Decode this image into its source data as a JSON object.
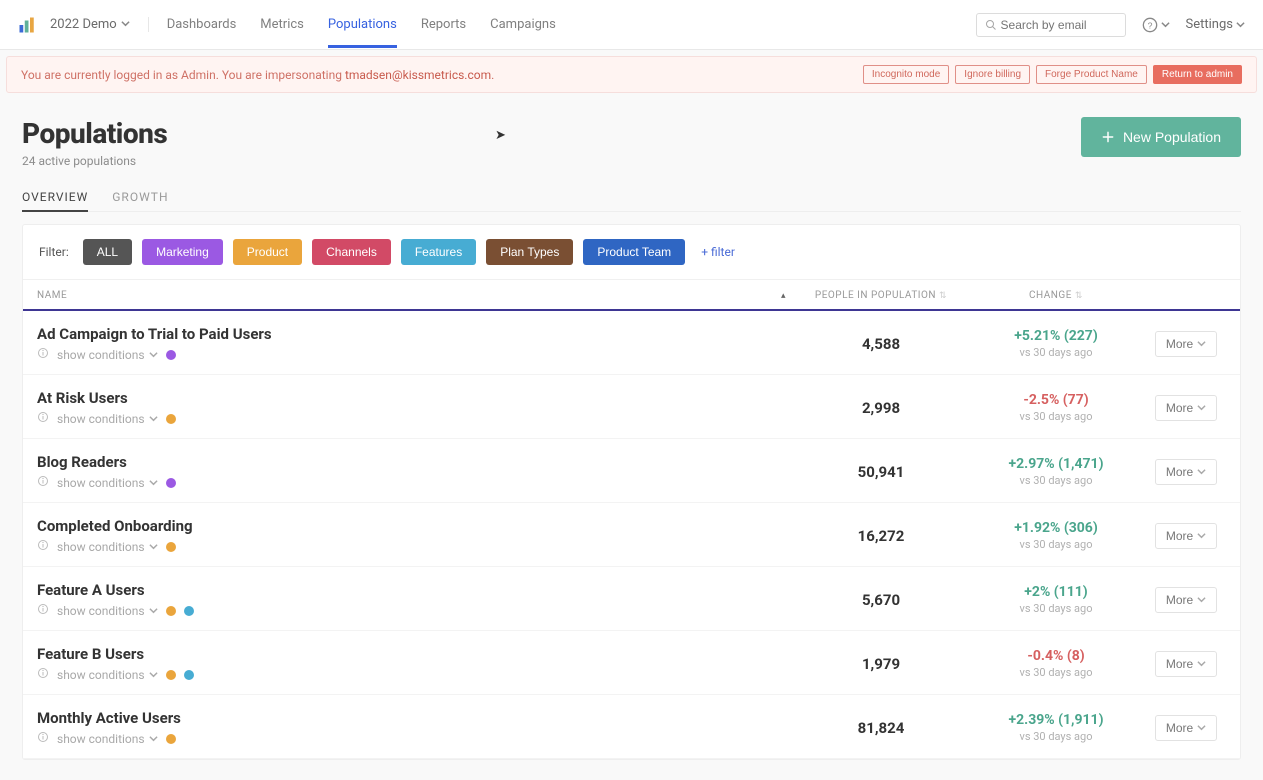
{
  "header": {
    "account_name": "2022 Demo",
    "nav": [
      "Dashboards",
      "Metrics",
      "Populations",
      "Reports",
      "Campaigns"
    ],
    "nav_active_index": 2,
    "search_placeholder": "Search by email",
    "settings_label": "Settings"
  },
  "impersonation": {
    "prefix": "You are currently logged in as Admin. You are impersonating ",
    "email": "tmadsen@kissmetrics.com",
    "suffix": ".",
    "buttons": [
      "Incognito mode",
      "Ignore billing",
      "Forge Product Name"
    ],
    "return_btn": "Return to admin"
  },
  "page": {
    "title": "Populations",
    "subtitle": "24 active populations",
    "tabs": [
      "OVERVIEW",
      "GROWTH"
    ],
    "active_tab": 0,
    "new_btn": "New Population",
    "filter_label": "Filter:",
    "filters": [
      {
        "label": "ALL",
        "cls": "chip-all"
      },
      {
        "label": "Marketing",
        "cls": "chip-marketing"
      },
      {
        "label": "Product",
        "cls": "chip-product"
      },
      {
        "label": "Channels",
        "cls": "chip-channels"
      },
      {
        "label": "Features",
        "cls": "chip-features"
      },
      {
        "label": "Plan Types",
        "cls": "chip-plans"
      },
      {
        "label": "Product Team",
        "cls": "chip-team"
      }
    ],
    "add_filter": "+ filter",
    "table_headers": {
      "name": "NAME",
      "people": "PEOPLE IN POPULATION",
      "change": "CHANGE"
    },
    "show_cond": "show conditions",
    "vs_text": "vs 30 days ago",
    "more_label": "More"
  },
  "rows": [
    {
      "name": "Ad Campaign to Trial to Paid Users",
      "count": "4,588",
      "delta": "+5.21% (227)",
      "dir": "pos",
      "tags": [
        "purple"
      ]
    },
    {
      "name": "At Risk Users",
      "count": "2,998",
      "delta": "-2.5% (77)",
      "dir": "neg",
      "tags": [
        "orange"
      ]
    },
    {
      "name": "Blog Readers",
      "count": "50,941",
      "delta": "+2.97% (1,471)",
      "dir": "pos",
      "tags": [
        "purple"
      ]
    },
    {
      "name": "Completed Onboarding",
      "count": "16,272",
      "delta": "+1.92% (306)",
      "dir": "pos",
      "tags": [
        "orange"
      ]
    },
    {
      "name": "Feature A Users",
      "count": "5,670",
      "delta": "+2% (111)",
      "dir": "pos",
      "tags": [
        "orange",
        "blue"
      ]
    },
    {
      "name": "Feature B Users",
      "count": "1,979",
      "delta": "-0.4% (8)",
      "dir": "neg",
      "tags": [
        "orange",
        "blue"
      ]
    },
    {
      "name": "Monthly Active Users",
      "count": "81,824",
      "delta": "+2.39% (1,911)",
      "dir": "pos",
      "tags": [
        "orange"
      ]
    }
  ]
}
